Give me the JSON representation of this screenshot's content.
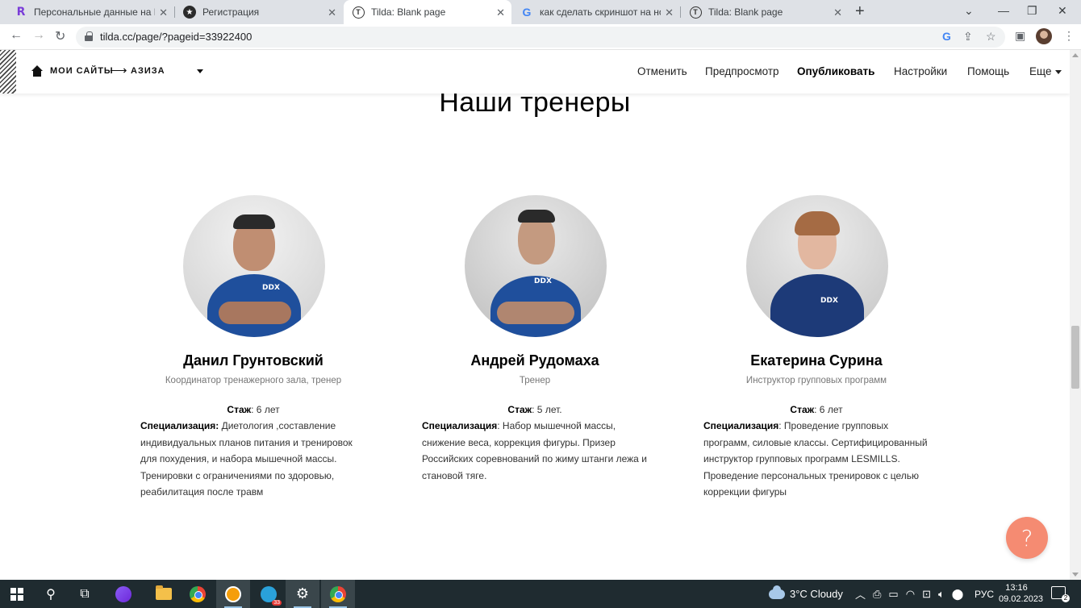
{
  "browser": {
    "tabs": [
      {
        "title": "Персональные данные на Freel",
        "icon": "fr-icon",
        "active": false
      },
      {
        "title": "Регистрация",
        "icon": "star-icon",
        "active": false
      },
      {
        "title": "Tilda: Blank page",
        "icon": "tilda-icon",
        "active": true
      },
      {
        "title": "как сделать скриншот на ноутб",
        "icon": "google-icon",
        "active": false
      },
      {
        "title": "Tilda: Blank page",
        "icon": "tilda-icon",
        "active": false
      }
    ],
    "url": "tilda.cc/page/?pageid=33922400"
  },
  "tilda": {
    "breadcrumb_sites": "МОИ САЙТЫ",
    "breadcrumb_project": "АЗИЗА",
    "menu": {
      "cancel": "Отменить",
      "preview": "Предпросмотр",
      "publish": "Опубликовать",
      "settings": "Настройки",
      "help": "Помощь",
      "more": "Еще"
    }
  },
  "section": {
    "title": "Наши тренеры"
  },
  "trainers": [
    {
      "name": "Данил Грунтовский",
      "role": "Координатор тренажерного зала, тренер",
      "exp_label": "Стаж",
      "exp_value": ": 6 лет",
      "spec_label": "Специализация:",
      "spec_text": " Диетология ,составление индивидуальных планов питания и тренировок для похудения, и набора мышечной массы. Тренировки с ограничениями по здоровью, реабилитация после травм"
    },
    {
      "name": "Андрей Рудомаха",
      "role": "Тренер",
      "exp_label": "Стаж",
      "exp_value": ": 5 лет.",
      "spec_label": "Специализация",
      "spec_text": ": Набор мышечной массы, снижение веса, коррекция фигуры. Призер Российских соревнований по жиму штанги лежа и становой тяге."
    },
    {
      "name": "Екатерина Сурина",
      "role": "Инструктор групповых программ",
      "exp_label": "Стаж",
      "exp_value": ": 6 лет",
      "spec_label": "Специализация",
      "spec_text": ": Проведение групповых программ, силовые классы. Сертифицированный инструктор групповых программ LESMILLS. Проведение персональных тренировок с целью коррекции фигуры"
    }
  ],
  "help_button": "?",
  "taskbar": {
    "telegram_badge": "33",
    "weather": "3°C  Cloudy",
    "language": "РУС",
    "time": "13:16",
    "date": "09.02.2023",
    "notifications": "2"
  },
  "colors": {
    "help_button": "#f58b72",
    "taskbar": "#1f2b30",
    "shirt_blue": "#1f4f9c"
  }
}
